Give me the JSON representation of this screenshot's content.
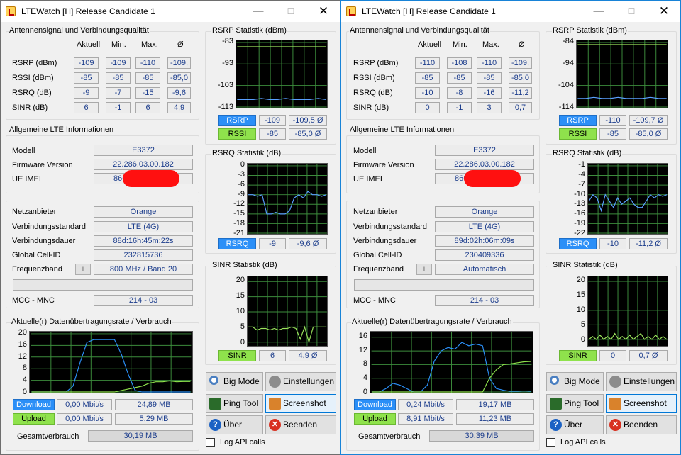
{
  "windows": [
    {
      "title": "LTEWatch [H]   Release Candidate 1",
      "signal": {
        "group_label": "Antennensignal und Verbindungsqualität",
        "headers": [
          "Aktuell",
          "Min.",
          "Max.",
          "Ø"
        ],
        "rows": [
          {
            "label": "RSRP (dBm)",
            "values": [
              "-109",
              "-109",
              "-110",
              "-109,"
            ]
          },
          {
            "label": "RSSI (dBm)",
            "values": [
              "-85",
              "-85",
              "-85",
              "-85,0"
            ]
          },
          {
            "label": "RSRQ (dB)",
            "values": [
              "-9",
              "-7",
              "-15",
              "-9,6"
            ]
          },
          {
            "label": "SINR (dB)",
            "values": [
              "6",
              "-1",
              "6",
              "4,9"
            ]
          }
        ]
      },
      "lte": {
        "group_label": "Allgemeine LTE Informationen",
        "model_label": "Modell",
        "model": "E3372",
        "firmware_label": "Firmware Version",
        "firmware": "22.286.03.00.182",
        "imei_label": "UE IMEI",
        "imei": "866"
      },
      "net": {
        "provider_label": "Netzanbieter",
        "provider": "Orange",
        "standard_label": "Verbindungsstandard",
        "standard": "LTE (4G)",
        "duration_label": "Verbindungsdauer",
        "duration": "88d:16h:45m:22s",
        "cell_label": "Global Cell-ID",
        "cell": "232815736",
        "band_label": "Frequenzband",
        "band_button": "+",
        "band": "800 MHz / Band 20",
        "mcc_label": "MCC - MNC",
        "mcc": "214 - 03"
      },
      "rate": {
        "group_label": "Aktuelle(r) Datenübertragungsrate / Verbrauch",
        "download_label": "Download",
        "download_rate": "0,00 Mbit/s",
        "download_total": "24,89 MB",
        "upload_label": "Upload",
        "upload_rate": "0,00 Mbit/s",
        "upload_total": "5,29 MB",
        "total_label": "Gesamtverbrauch",
        "total": "30,19 MB"
      },
      "rsrp_stat": {
        "group_label": "RSRP Statistik (dBm)",
        "rsrp_label": "RSRP",
        "rsrp_now": "-109",
        "rsrp_avg": "-109,5 Ø",
        "rssi_label": "RSSI",
        "rssi_now": "-85",
        "rssi_avg": "-85,0 Ø"
      },
      "rsrq_stat": {
        "group_label": "RSRQ Statistik (dB)",
        "label": "RSRQ",
        "now": "-9",
        "avg": "-9,6 Ø"
      },
      "sinr_stat": {
        "group_label": "SINR Statistik (dB)",
        "label": "SINR",
        "now": "6",
        "avg": "4,9 Ø"
      },
      "buttons": {
        "big_mode": "Big Mode",
        "settings": "Einstellungen",
        "ping": "Ping Tool",
        "screenshot": "Screenshot",
        "about": "Über",
        "quit": "Beenden",
        "log": "Log API calls"
      }
    },
    {
      "title": "LTEWatch [H]   Release Candidate 1",
      "signal": {
        "group_label": "Antennensignal und Verbindungsqualität",
        "headers": [
          "Aktuell",
          "Min.",
          "Max.",
          "Ø"
        ],
        "rows": [
          {
            "label": "RSRP (dBm)",
            "values": [
              "-110",
              "-108",
              "-110",
              "-109,"
            ]
          },
          {
            "label": "RSSI (dBm)",
            "values": [
              "-85",
              "-85",
              "-85",
              "-85,0"
            ]
          },
          {
            "label": "RSRQ (dB)",
            "values": [
              "-10",
              "-8",
              "-16",
              "-11,2"
            ]
          },
          {
            "label": "SINR (dB)",
            "values": [
              "0",
              "-1",
              "3",
              "0,7"
            ]
          }
        ]
      },
      "lte": {
        "group_label": "Allgemeine LTE Informationen",
        "model_label": "Modell",
        "model": "E3372",
        "firmware_label": "Firmware Version",
        "firmware": "22.286.03.00.182",
        "imei_label": "UE IMEI",
        "imei": "866"
      },
      "net": {
        "provider_label": "Netzanbieter",
        "provider": "Orange",
        "standard_label": "Verbindungsstandard",
        "standard": "LTE (4G)",
        "duration_label": "Verbindungsdauer",
        "duration": "89d:02h:06m:09s",
        "cell_label": "Global Cell-ID",
        "cell": "230409336",
        "band_label": "Frequenzband",
        "band_button": "+",
        "band": "Automatisch",
        "mcc_label": "MCC - MNC",
        "mcc": "214 - 03"
      },
      "rate": {
        "group_label": "Aktuelle(r) Datenübertragungsrate / Verbrauch",
        "download_label": "Download",
        "download_rate": "0,24 Mbit/s",
        "download_total": "19,17 MB",
        "upload_label": "Upload",
        "upload_rate": "8,91 Mbit/s",
        "upload_total": "11,23 MB",
        "total_label": "Gesamtverbrauch",
        "total": "30,39 MB"
      },
      "rsrp_stat": {
        "group_label": "RSRP Statistik (dBm)",
        "rsrp_label": "RSRP",
        "rsrp_now": "-110",
        "rsrp_avg": "-109,7 Ø",
        "rssi_label": "RSSI",
        "rssi_now": "-85",
        "rssi_avg": "-85,0 Ø"
      },
      "rsrq_stat": {
        "group_label": "RSRQ Statistik (dB)",
        "label": "RSRQ",
        "now": "-10",
        "avg": "-11,2 Ø"
      },
      "sinr_stat": {
        "group_label": "SINR Statistik (dB)",
        "label": "SINR",
        "now": "0",
        "avg": "0,7 Ø"
      },
      "buttons": {
        "big_mode": "Big Mode",
        "settings": "Einstellungen",
        "ping": "Ping Tool",
        "screenshot": "Screenshot",
        "about": "Über",
        "quit": "Beenden",
        "log": "Log API calls"
      }
    }
  ],
  "colors": {
    "plot_bg": "#000000",
    "grid": "#3c8c3c",
    "rsrp": "#5aa0ff",
    "rssi": "#9be35c",
    "download": "#2b8ff7",
    "upload": "#8fe24c"
  },
  "chart_data": [
    {
      "type": "line",
      "window": 0,
      "title": "RSRP Statistik (dBm)",
      "yticks": [
        "-83",
        "-93",
        "-103",
        "-113"
      ],
      "ylim": [
        -113,
        -83
      ],
      "series": [
        {
          "name": "RSRP",
          "values": [
            -109.5,
            -109.5,
            -109.5,
            -109,
            -109.5,
            -109.5,
            -109,
            -109.5,
            -109.5,
            -109.5,
            -109,
            -109.5
          ]
        },
        {
          "name": "RSSI",
          "values": [
            -85,
            -85,
            -85,
            -85,
            -85,
            -85,
            -85,
            -85,
            -85,
            -85,
            -85,
            -85
          ]
        }
      ]
    },
    {
      "type": "line",
      "window": 0,
      "title": "RSRQ Statistik (dB)",
      "yticks": [
        "0",
        "-3",
        "-6",
        "-9",
        "-12",
        "-15",
        "-18",
        "-21"
      ],
      "ylim": [
        -21,
        0
      ],
      "series": [
        {
          "name": "RSRQ",
          "values": [
            -9,
            -9,
            -9.5,
            -9,
            -15,
            -15,
            -14.5,
            -15,
            -15,
            -14,
            -10,
            -9,
            -10,
            -8,
            -9,
            -9,
            -9.5,
            -9
          ]
        }
      ]
    },
    {
      "type": "line",
      "window": 0,
      "title": "SINR Statistik (dB)",
      "yticks": [
        "20",
        "15",
        "10",
        "5",
        "0"
      ],
      "ylim": [
        -1,
        21
      ],
      "series": [
        {
          "name": "SINR",
          "values": [
            5,
            5,
            4,
            4.5,
            4.5,
            4,
            4.5,
            4,
            4.5,
            4.5,
            5,
            4.5,
            1,
            5,
            0,
            5,
            5,
            5,
            5
          ]
        }
      ]
    },
    {
      "type": "line",
      "window": 0,
      "title": "Aktuelle(r) Datenübertragungsrate / Verbrauch",
      "yticks": [
        "20",
        "16",
        "12",
        "8",
        "4",
        "0"
      ],
      "ylim": [
        0,
        20
      ],
      "series": [
        {
          "name": "Download",
          "values": [
            0,
            0,
            0,
            0,
            0,
            0,
            2,
            10,
            17,
            18,
            18,
            18,
            18,
            13,
            6,
            0.5,
            0,
            0,
            0,
            0,
            0,
            0,
            0,
            0
          ]
        },
        {
          "name": "Upload",
          "values": [
            0,
            0,
            0,
            0,
            0,
            0,
            0,
            0,
            0,
            0,
            0,
            0,
            0,
            0.5,
            1,
            1.5,
            2,
            3,
            3.5,
            3.5,
            3.8,
            3.5,
            3.6,
            3.6
          ]
        }
      ]
    },
    {
      "type": "line",
      "window": 1,
      "title": "RSRP Statistik (dBm)",
      "yticks": [
        "-84",
        "-94",
        "-104",
        "-114"
      ],
      "ylim": [
        -114,
        -84
      ],
      "series": [
        {
          "name": "RSRP",
          "values": [
            -110,
            -110,
            -109.5,
            -110,
            -110,
            -109.5,
            -110,
            -110,
            -110,
            -109.5,
            -110,
            -110
          ]
        },
        {
          "name": "RSSI",
          "values": [
            -85,
            -85,
            -85,
            -85,
            -85,
            -85,
            -85,
            -85,
            -85,
            -85,
            -85,
            -85
          ]
        }
      ]
    },
    {
      "type": "line",
      "window": 1,
      "title": "RSRQ Statistik (dB)",
      "yticks": [
        "-1",
        "-4",
        "-7",
        "-10",
        "-13",
        "-16",
        "-19",
        "-22"
      ],
      "ylim": [
        -22,
        -1
      ],
      "series": [
        {
          "name": "RSRQ",
          "values": [
            -12,
            -10,
            -11,
            -15,
            -10,
            -12,
            -14,
            -11,
            -13,
            -12,
            -11,
            -13,
            -14,
            -14,
            -12,
            -10,
            -11,
            -10,
            -10.5,
            -10
          ]
        }
      ]
    },
    {
      "type": "line",
      "window": 1,
      "title": "SINR Statistik (dB)",
      "yticks": [
        "20",
        "15",
        "10",
        "5",
        "0"
      ],
      "ylim": [
        -2,
        21
      ],
      "series": [
        {
          "name": "SINR",
          "values": [
            0,
            1,
            0,
            1.5,
            0,
            1,
            0,
            2,
            0,
            1,
            0,
            1.5,
            0,
            1,
            2,
            0,
            1,
            0,
            1.5,
            0,
            1,
            0
          ]
        }
      ]
    },
    {
      "type": "line",
      "window": 1,
      "title": "Aktuelle(r) Datenübertragungsrate / Verbrauch",
      "yticks": [
        "16",
        "12",
        "8",
        "4",
        "0"
      ],
      "ylim": [
        0,
        17
      ],
      "series": [
        {
          "name": "Download",
          "values": [
            0,
            0,
            1,
            2.5,
            2,
            1,
            0,
            0,
            2,
            9,
            12,
            13,
            12.5,
            14.5,
            13.5,
            14,
            13.5,
            4,
            1,
            0.5,
            0.2,
            0.2,
            0.3,
            0.2
          ]
        },
        {
          "name": "Upload",
          "values": [
            0,
            0,
            0,
            0,
            0,
            0,
            0,
            0,
            0,
            0,
            0,
            0,
            0,
            0,
            0,
            0,
            0,
            4,
            6.5,
            8,
            8.2,
            8.5,
            8.8,
            8.9
          ]
        }
      ]
    }
  ]
}
